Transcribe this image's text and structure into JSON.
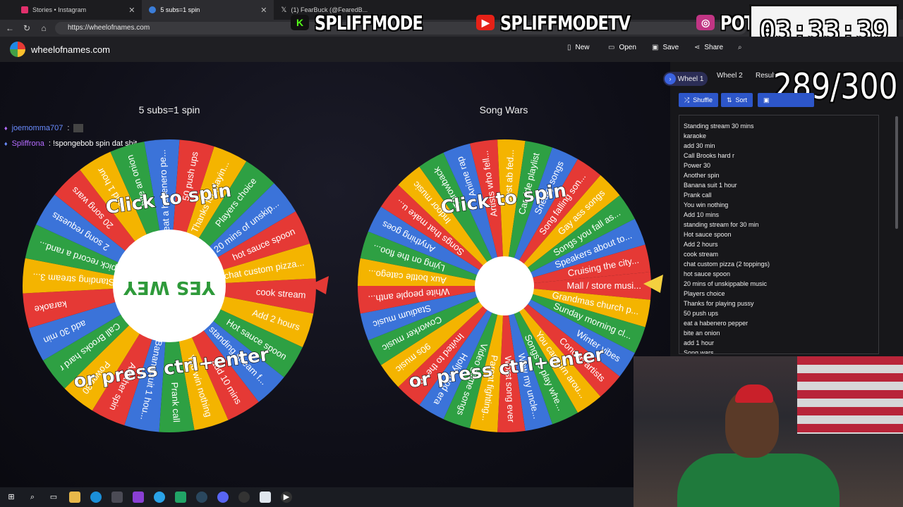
{
  "browser": {
    "tabs": [
      {
        "label": "Stories • Instagram",
        "color": "#e1306c"
      },
      {
        "label": "5 subs=1 spin",
        "color": "#3b7dd8"
      },
      {
        "label": "(1) FearBuck (@FearedB...",
        "color": "#000000"
      }
    ],
    "url": "https://wheelofnames.com"
  },
  "overlay": {
    "brands": [
      "SPLIFFMODE",
      "SPLIFFMODETV",
      "POTLORD"
    ],
    "timer": "03:33:39",
    "counter": "289/300"
  },
  "site": {
    "name": "wheelofnames.com",
    "actions": {
      "new": "New",
      "open": "Open",
      "save": "Save",
      "share": "Share"
    }
  },
  "wheels": {
    "left": {
      "title": "5 subs=1 spin",
      "spin_text": "Click to spin",
      "press_text": "or press ctrl+enter",
      "center": "YES WEY",
      "labels": [
        "cook stream",
        "Add 2 hours",
        "Hot sauce spoon",
        "standing stream f...",
        "add 10 mins",
        "You win nothing",
        "Prank call",
        "Banana suit 1 hou...",
        "Another spin",
        "Power 30",
        "Call Brooks hard r",
        "add 30 min",
        "karaoke",
        "Standing stream 3...",
        "pick record a rand...",
        "2 song requests",
        "20 song wars",
        "add 1 hour",
        "bite an onion",
        "eat a habenero pe...",
        "50 push ups",
        "Thanks for playin...",
        "Players choice",
        "20 mins of unskip...",
        "hot sauce spoon",
        "chat custom pizza..."
      ]
    },
    "right": {
      "title": "Song Wars",
      "spin_text": "Click to spin",
      "press_text": "or press ctrl+enter",
      "labels": [
        "Mall / store musi...",
        "Grandmas church p...",
        "Sunday morning cl...",
        "Winter vibes",
        "Concert artists",
        "You can turn arou...",
        "Songs to play whe...",
        "Wow my uncle...",
        "Worst song ever",
        "Parent fighting...",
        "Video game songs",
        "Hollywood era",
        "Invited to the co...",
        "90s music",
        "Coworker music",
        "Stadium music",
        "White people anth...",
        "Aux bottle catego...",
        "Lying on the floo...",
        "Anything goes",
        "Songs that make u...",
        "Indoor music",
        "Throwback",
        "Anime rap",
        "Artists who fell...",
        "Best ab fed...",
        "Car ride playlist",
        "Sneaky songs",
        "Song falling son...",
        "Gay ass songs",
        "Songs you fall as...",
        "Speakers about to...",
        "Cruising the city..."
      ]
    }
  },
  "chat": [
    {
      "name": "joemomma707",
      "message": ""
    },
    {
      "name": "Spliffrona",
      "message": "!spongebob spin dat shit"
    }
  ],
  "panel": {
    "tabs": [
      "Wheel 1",
      "Wheel 2",
      "Results"
    ],
    "buttons": {
      "shuffle": "Shuffle",
      "sort": "Sort"
    },
    "entries": [
      "Standing stream 30 mins",
      "karaoke",
      "add 30 min",
      "Call Brooks hard r",
      "Power 30",
      "Another spin",
      "Banana suit 1 hour",
      "Prank call",
      "You win nothing",
      "Add 10 mins",
      "standing stream for 30 min",
      "Hot sauce spoon",
      "Add 2 hours",
      "cook stream",
      "chat custom pizza (2 toppings)",
      "hot sauce spoon",
      "20 mins of unskippable music",
      "Players choice",
      "Thanks for playing pussy",
      "50 push ups",
      "eat a habenero pepper",
      "bite an onion",
      "add 1 hour",
      "Song wars"
    ]
  },
  "colors": {
    "red": "#e53935",
    "yellow": "#f4b400",
    "green": "#2ea043",
    "blue": "#3b73d9",
    "accent": "#2d56c9"
  }
}
